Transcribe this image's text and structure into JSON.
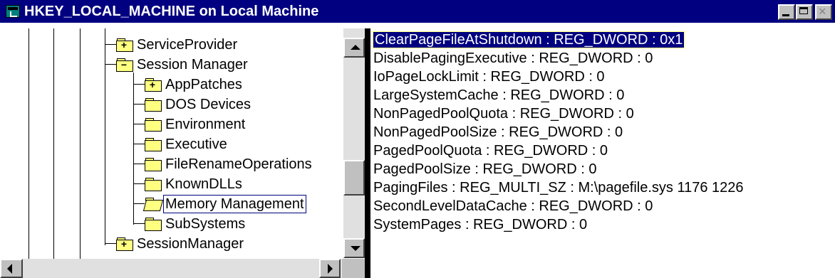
{
  "window": {
    "title": "HKEY_LOCAL_MACHINE on Local Machine",
    "controls": {
      "minimize": "minimize",
      "maximize": "maximize",
      "close": "×"
    }
  },
  "tree": {
    "items": [
      {
        "label": "ServiceProvider",
        "indent": 1,
        "expandable": true
      },
      {
        "label": "Session Manager",
        "indent": 1,
        "expanded": true
      },
      {
        "label": "AppPatches",
        "indent": 2,
        "expandable": true
      },
      {
        "label": "DOS Devices",
        "indent": 2
      },
      {
        "label": "Environment",
        "indent": 2
      },
      {
        "label": "Executive",
        "indent": 2
      },
      {
        "label": "FileRenameOperations",
        "indent": 2
      },
      {
        "label": "KnownDLLs",
        "indent": 2
      },
      {
        "label": "Memory Management",
        "indent": 2,
        "selected": true,
        "open": true
      },
      {
        "label": "SubSystems",
        "indent": 2
      },
      {
        "label": "SessionManager",
        "indent": 1,
        "expandable": true
      }
    ]
  },
  "values": [
    {
      "text": "ClearPageFileAtShutdown : REG_DWORD : 0x1",
      "selected": true
    },
    {
      "text": "DisablePagingExecutive : REG_DWORD : 0"
    },
    {
      "text": "IoPageLockLimit : REG_DWORD : 0"
    },
    {
      "text": "LargeSystemCache : REG_DWORD : 0"
    },
    {
      "text": "NonPagedPoolQuota : REG_DWORD : 0"
    },
    {
      "text": "NonPagedPoolSize : REG_DWORD : 0"
    },
    {
      "text": "PagedPoolQuota : REG_DWORD : 0"
    },
    {
      "text": "PagedPoolSize : REG_DWORD : 0"
    },
    {
      "text": "PagingFiles : REG_MULTI_SZ : M:\\pagefile.sys 1176 1226"
    },
    {
      "text": "SecondLevelDataCache : REG_DWORD : 0"
    },
    {
      "text": "SystemPages : REG_DWORD : 0"
    }
  ],
  "icons": {
    "app": "registry-editor-icon",
    "folder": "folder-icon",
    "folder_open": "folder-open-icon",
    "expand": "plus-sign-icon",
    "collapse": "minus-sign-icon"
  },
  "colors": {
    "titlebar": "#000080",
    "selection": "#000080",
    "folder": "#ffff80",
    "chrome": "#c0c0c0"
  }
}
